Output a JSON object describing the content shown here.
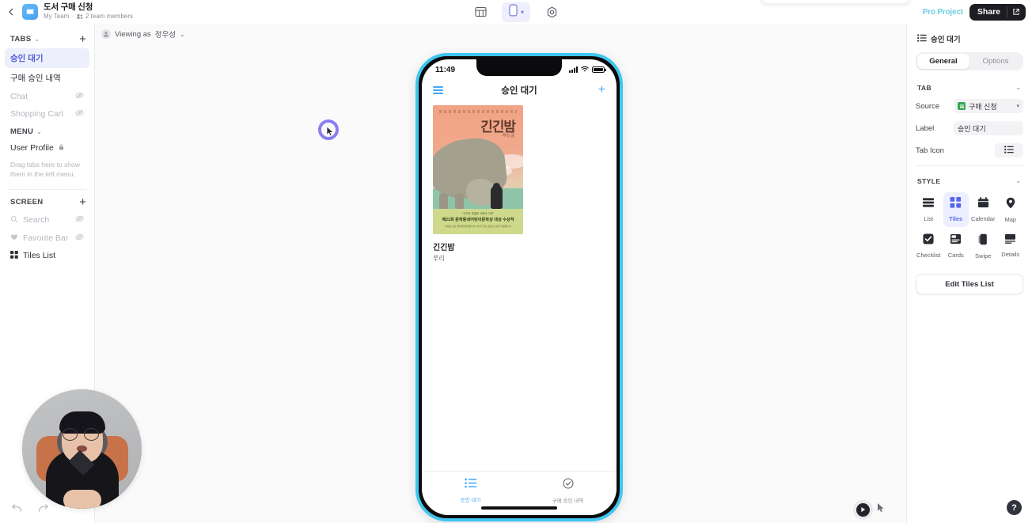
{
  "topbar": {
    "back_icon": "chevron-left-icon",
    "app_icon": "book-app-icon",
    "title": "도서 구매 신청",
    "team": "My Team",
    "dot": "·",
    "members": "2 team members",
    "members_icon": "people-icon",
    "center": {
      "table_icon": "table-view-icon",
      "device_icon": "mobile-device-icon",
      "device_caret": "▾",
      "settings_icon": "gear-icon"
    },
    "pro_label": "Pro Project",
    "share_label": "Share",
    "share_ext_icon": "external-link-icon"
  },
  "sidebar": {
    "tabs_section": {
      "title": "TABS",
      "caret": "⌄",
      "plus": "+"
    },
    "tabs": [
      {
        "label": "승인 대기",
        "state": "active",
        "eye": ""
      },
      {
        "label": "구매 승인 내역",
        "state": "normal",
        "eye": ""
      },
      {
        "label": "Chat",
        "state": "hidden",
        "eye": "eye-off-icon"
      },
      {
        "label": "Shopping Cart",
        "state": "hidden",
        "eye": "eye-off-icon"
      }
    ],
    "menu_section": {
      "title": "MENU",
      "caret": "⌄"
    },
    "menu_items": [
      {
        "label": "User Profile",
        "lock": "lock-icon"
      }
    ],
    "menu_hint": "Drag tabs here to show them in the left menu.",
    "screen_section": {
      "title": "SCREEN",
      "plus": "+"
    },
    "screen_items": [
      {
        "label": "Search",
        "icon": "search-icon",
        "state": "hidden",
        "eye": "eye-off-icon"
      },
      {
        "label": "Favorite Bar",
        "icon": "heart-icon",
        "state": "hidden",
        "eye": "eye-off-icon"
      },
      {
        "label": "Tiles List",
        "icon": "tiles-icon",
        "state": "normal",
        "eye": ""
      }
    ]
  },
  "canvas": {
    "viewing_as_prefix": "Viewing as",
    "viewing_as_user": "정우성",
    "viewing_caret": "⌄",
    "avatar_icon": "user-avatar-icon",
    "cursor_icon": "loading-cursor-icon"
  },
  "phone": {
    "status_time": "11:49",
    "signal_icon": "signal-bars-icon",
    "wifi_icon": "wifi-icon",
    "battery_icon": "battery-icon",
    "header": {
      "menu_icon": "hamburger-menu-icon",
      "title": "승인 대기",
      "add_icon": "plus-icon"
    },
    "book": {
      "cover_title": "긴긴밤",
      "cover_author_kr": "루리 글",
      "band_line1": "\"자기만 특별한 사랑의 기록\"",
      "band_line2": "제21회 문학동네어린이문학상 대상 수상작",
      "band_line3": "이세상 모든 들에게 말하렵니다 아이가 되는 글쓰는 이의 다정합니다",
      "title": "긴긴밤",
      "author": "루리"
    },
    "tabbar": [
      {
        "label": "승인 대기",
        "icon": "list-icon",
        "active": true
      },
      {
        "label": "구매 승인 내역",
        "icon": "check-circle-icon",
        "active": false
      }
    ]
  },
  "right_panel": {
    "header_icon": "list-icon",
    "header_title": "승인 대기",
    "segments": [
      {
        "label": "General",
        "active": true
      },
      {
        "label": "Options",
        "active": false
      }
    ],
    "tab_section": {
      "title": "TAB",
      "caret": "⌄"
    },
    "source_label": "Source",
    "source_value": "구매 신청",
    "source_icon": "google-sheets-icon",
    "source_caret": "▾",
    "label_label": "Label",
    "label_value": "승인 대기",
    "tab_icon_label": "Tab Icon",
    "tab_icon_value": "list-icon",
    "style_section": {
      "title": "STYLE",
      "caret": "⌄"
    },
    "styles": [
      {
        "label": "List",
        "icon": "list-layout-icon",
        "active": false
      },
      {
        "label": "Tiles",
        "icon": "tiles-layout-icon",
        "active": true
      },
      {
        "label": "Calendar",
        "icon": "calendar-icon",
        "active": false
      },
      {
        "label": "Map",
        "icon": "map-pin-icon",
        "active": false
      },
      {
        "label": "Checklist",
        "icon": "checkbox-icon",
        "active": false
      },
      {
        "label": "Cards",
        "icon": "cards-icon",
        "active": false
      },
      {
        "label": "Swipe",
        "icon": "swipe-icon",
        "active": false
      },
      {
        "label": "Details",
        "icon": "details-icon",
        "active": false
      }
    ],
    "edit_button": "Edit Tiles List"
  },
  "bottom": {
    "undo_icon": "undo-icon",
    "redo_icon": "redo-icon",
    "play_icon": "play-icon",
    "pointer_icon": "cursor-pointer-icon",
    "help_label": "?"
  },
  "colors": {
    "accent_purple": "#5566e8",
    "accent_blue": "#45a8f5",
    "phone_border": "#3ec6f0",
    "pro_teal": "#6ecfe0",
    "sheets_green": "#34a853"
  }
}
